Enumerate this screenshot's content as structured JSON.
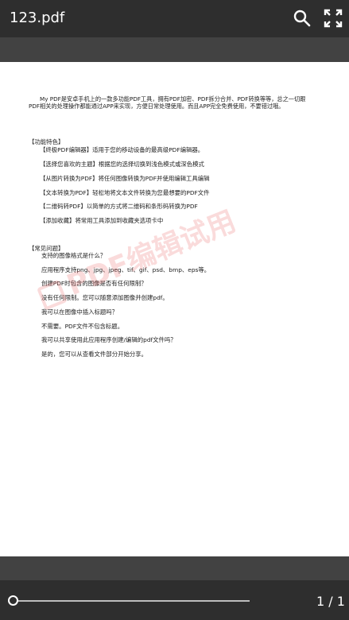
{
  "header": {
    "title": "123.pdf",
    "search_icon": "search-icon",
    "fullscreen_icon": "fullscreen-icon"
  },
  "document": {
    "intro": "My PDF是安卓手机上的一款多功能PDF工具，拥有PDF加密、PDF拆分合并、PDF转换等等，总之一切跟PDF相关的处理操作都能通过APP来实现，方便日常处理使用。而且APP完全免费使用，不要错过哦。",
    "features_heading": "【功能特色】",
    "features": [
      "【终极PDF编辑器】适用于您的移动设备的最高级PDF编辑器。",
      "【选择您喜欢的主题】根据您的选择切换到浅色模式或深色模式",
      "【从图片转换为PDF】将任何图像转换为PDF并使用编辑工具编辑",
      "【文本转换为PDF】轻松地将文本文件转换为您最想要的PDF文件",
      "【二维码转PDF】以简单的方式将二维码和条形码转换为PDF",
      "【添加收藏】将常用工具添加到收藏夹选项卡中"
    ],
    "faq_heading": "【常见问题】",
    "faq": [
      "支持的图像格式是什么？",
      "应用程序支持png、jpg、jpeg、tif、gif、psd、bmp、eps等。",
      "创建PDF时包含的图像是否有任何限制？",
      "没有任何限制。您可以随意添加图像并创建pdf。",
      "我可以在图像中插入标题吗？",
      "不需要。PDF文件不包含标题。",
      "我可以共享使用此应用程序创建/编辑的pdf文件吗？",
      "是的，您可以从查看文件部分开始分享。"
    ],
    "watermark": "PDF编辑试用"
  },
  "footer": {
    "page_indicator": "1 / 1",
    "progress": 0.0
  },
  "colors": {
    "appbar": "#2e2e2e",
    "subbar": "#424242",
    "watermark": "#e65a5a"
  }
}
